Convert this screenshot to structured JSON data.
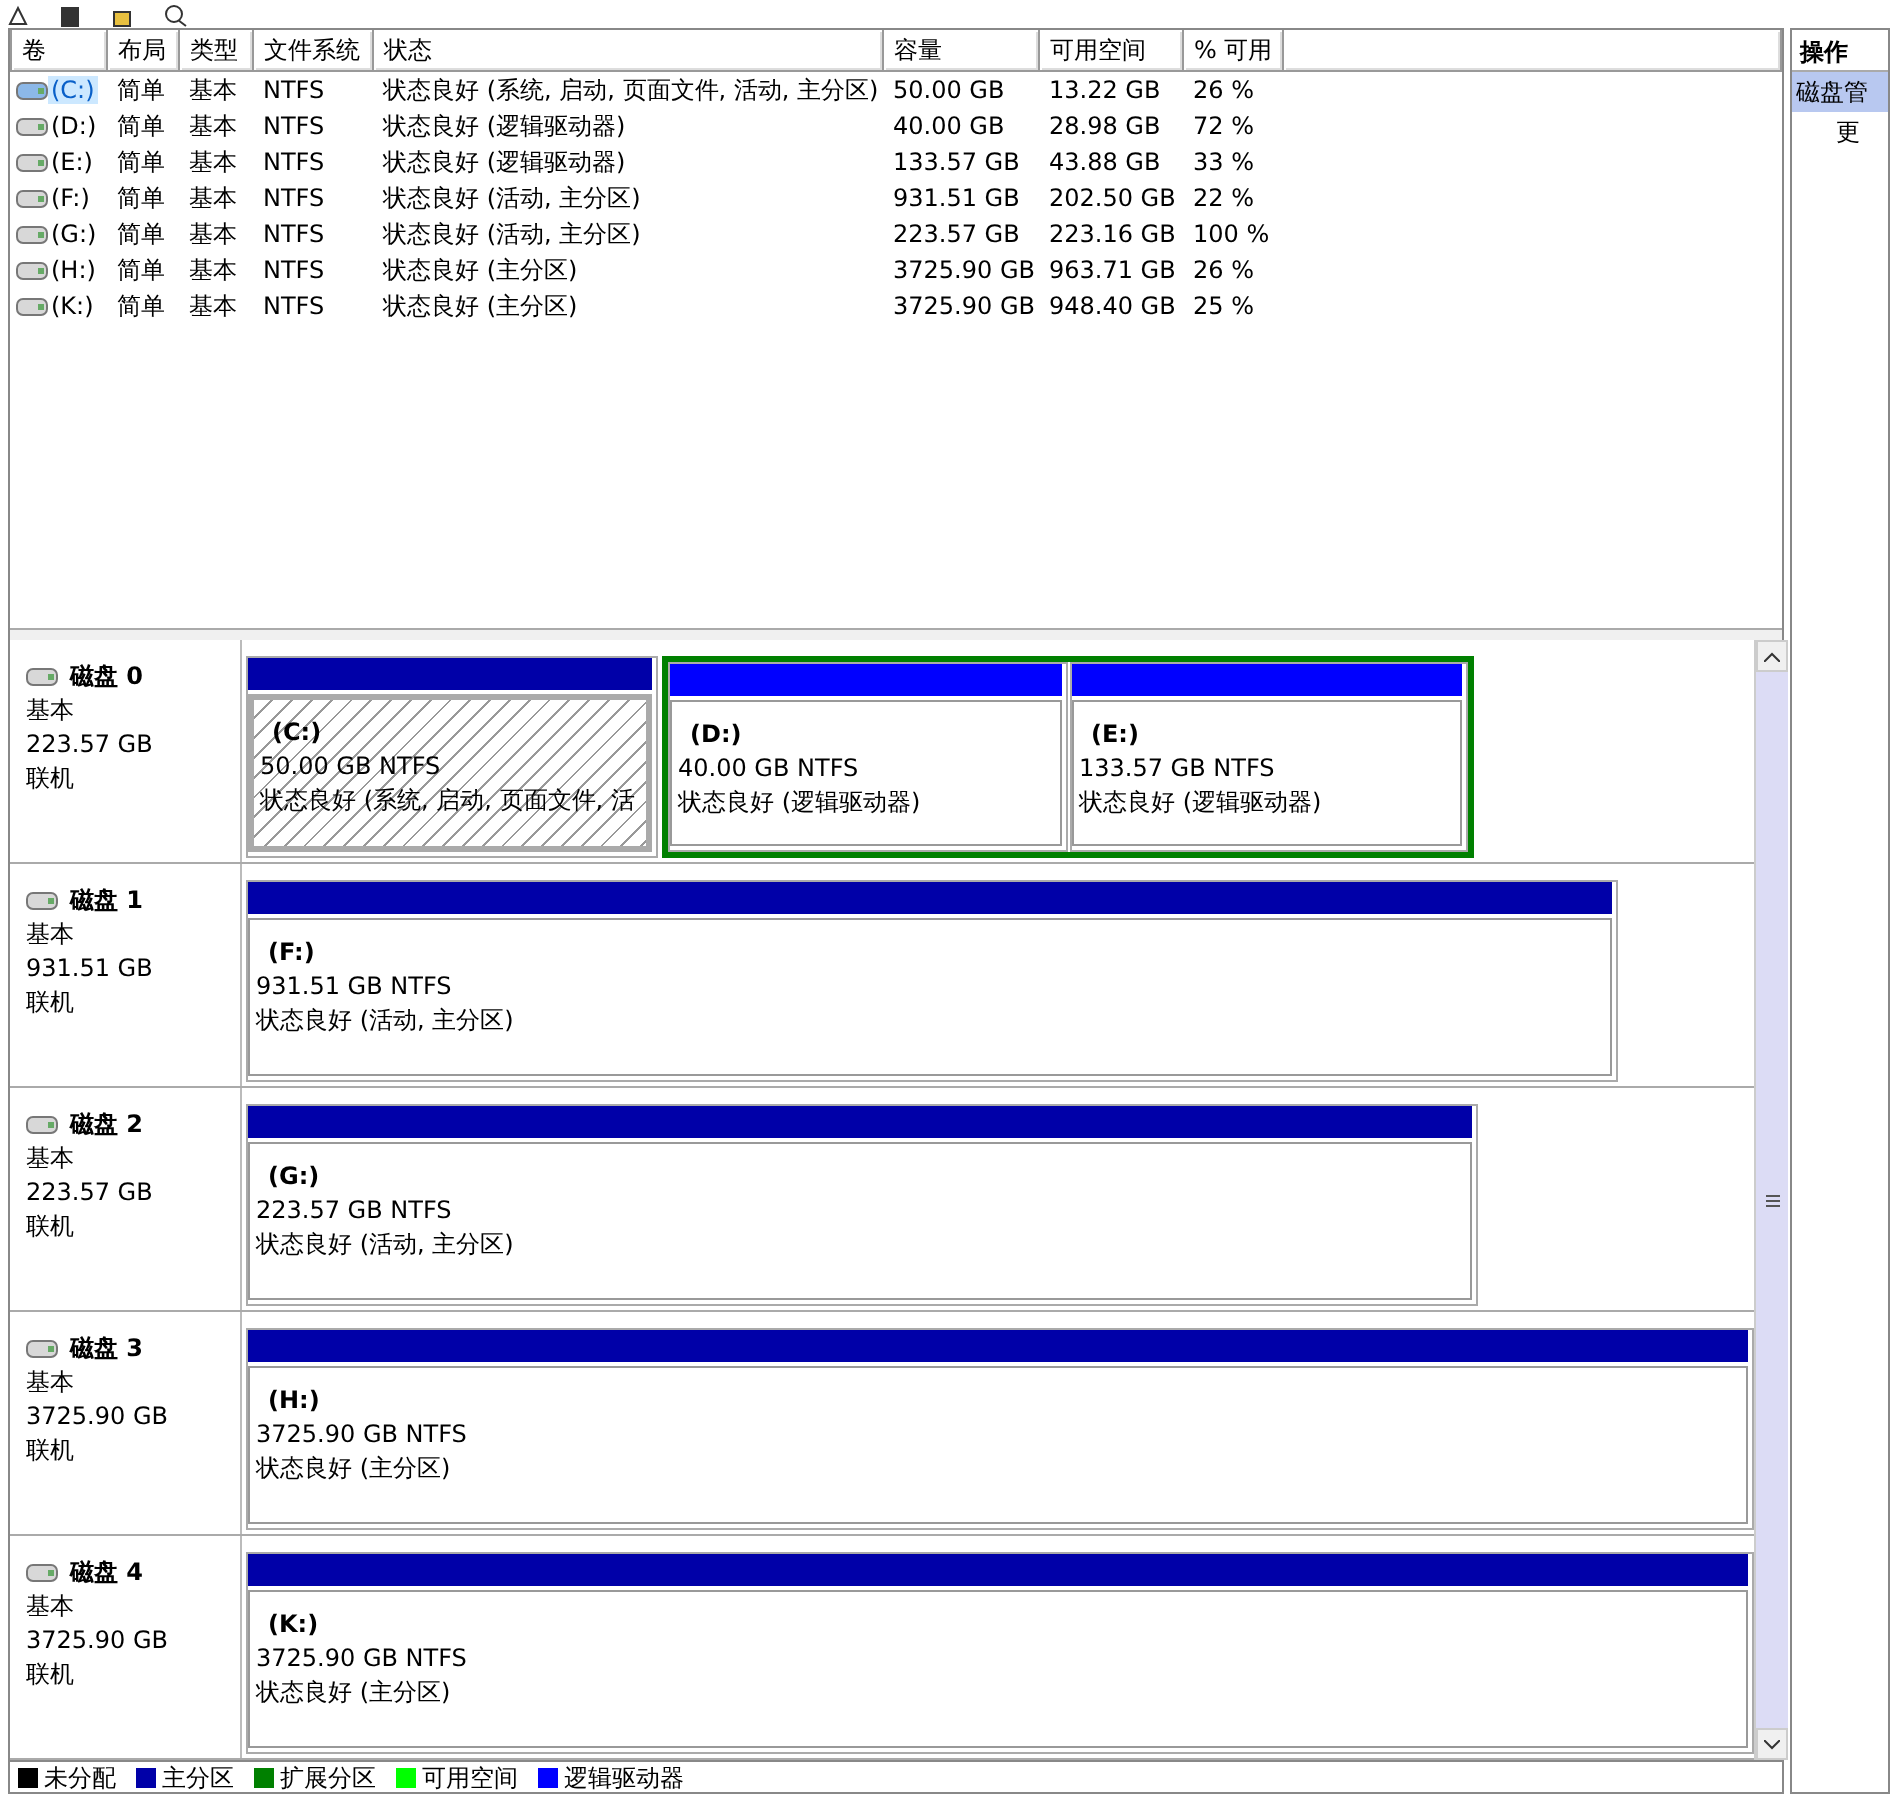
{
  "volume_list": {
    "columns": [
      "卷",
      "布局",
      "类型",
      "文件系统",
      "状态",
      "容量",
      "可用空间",
      "% 可用"
    ],
    "rows": [
      {
        "volume": "(C:)",
        "layout": "简单",
        "type": "基本",
        "file_system": "NTFS",
        "status": "状态良好 (系统, 启动, 页面文件, 活动, 主分区)",
        "capacity": "50.00 GB",
        "free_space": "13.22 GB",
        "percent_free": "26 %",
        "selected": true
      },
      {
        "volume": "(D:)",
        "layout": "简单",
        "type": "基本",
        "file_system": "NTFS",
        "status": "状态良好 (逻辑驱动器)",
        "capacity": "40.00 GB",
        "free_space": "28.98 GB",
        "percent_free": "72 %",
        "selected": false
      },
      {
        "volume": "(E:)",
        "layout": "简单",
        "type": "基本",
        "file_system": "NTFS",
        "status": "状态良好 (逻辑驱动器)",
        "capacity": "133.57 GB",
        "free_space": "43.88 GB",
        "percent_free": "33 %",
        "selected": false
      },
      {
        "volume": "(F:)",
        "layout": "简单",
        "type": "基本",
        "file_system": "NTFS",
        "status": "状态良好 (活动, 主分区)",
        "capacity": "931.51 GB",
        "free_space": "202.50 GB",
        "percent_free": "22 %",
        "selected": false
      },
      {
        "volume": "(G:)",
        "layout": "简单",
        "type": "基本",
        "file_system": "NTFS",
        "status": "状态良好 (活动, 主分区)",
        "capacity": "223.57 GB",
        "free_space": "223.16 GB",
        "percent_free": "100 %",
        "selected": false
      },
      {
        "volume": "(H:)",
        "layout": "简单",
        "type": "基本",
        "file_system": "NTFS",
        "status": "状态良好 (主分区)",
        "capacity": "3725.90 GB",
        "free_space": "963.71 GB",
        "percent_free": "26 %",
        "selected": false
      },
      {
        "volume": "(K:)",
        "layout": "简单",
        "type": "基本",
        "file_system": "NTFS",
        "status": "状态良好 (主分区)",
        "capacity": "3725.90 GB",
        "free_space": "948.40 GB",
        "percent_free": "25 %",
        "selected": false
      }
    ]
  },
  "disks": [
    {
      "name": "磁盘 0",
      "type": "基本",
      "size": "223.57 GB",
      "status": "联机",
      "partitions": [
        {
          "kind": "primary",
          "label": "(C:)",
          "size": "50.00 GB NTFS",
          "status": "状态良好 (系统, 启动, 页面文件, 活",
          "selected": true
        },
        {
          "kind": "extended",
          "selected": false,
          "children": [
            {
              "kind": "logical",
              "label": "(D:)",
              "size": "40.00 GB NTFS",
              "status": "状态良好 (逻辑驱动器)",
              "selected": false
            },
            {
              "kind": "logical",
              "label": "(E:)",
              "size": "133.57 GB NTFS",
              "status": "状态良好 (逻辑驱动器)",
              "selected": false
            }
          ]
        }
      ]
    },
    {
      "name": "磁盘 1",
      "type": "基本",
      "size": "931.51 GB",
      "status": "联机",
      "partitions": [
        {
          "kind": "primary",
          "label": "(F:)",
          "size": "931.51 GB NTFS",
          "status": "状态良好 (活动, 主分区)",
          "selected": false
        }
      ]
    },
    {
      "name": "磁盘 2",
      "type": "基本",
      "size": "223.57 GB",
      "status": "联机",
      "partitions": [
        {
          "kind": "primary",
          "label": "(G:)",
          "size": "223.57 GB NTFS",
          "status": "状态良好 (活动, 主分区)",
          "selected": false
        }
      ]
    },
    {
      "name": "磁盘 3",
      "type": "基本",
      "size": "3725.90 GB",
      "status": "联机",
      "partitions": [
        {
          "kind": "primary",
          "label": "(H:)",
          "size": "3725.90 GB NTFS",
          "status": "状态良好 (主分区)",
          "selected": false
        }
      ]
    },
    {
      "name": "磁盘 4",
      "type": "基本",
      "size": "3725.90 GB",
      "status": "联机",
      "partitions": [
        {
          "kind": "primary",
          "label": "(K:)",
          "size": "3725.90 GB NTFS",
          "status": "状态良好 (主分区)",
          "selected": false
        }
      ]
    }
  ],
  "legend": [
    {
      "label": "未分配",
      "color": "#000000"
    },
    {
      "label": "主分区",
      "color": "#0000a8"
    },
    {
      "label": "扩展分区",
      "color": "#008000"
    },
    {
      "label": "可用空间",
      "color": "#00ff00"
    },
    {
      "label": "逻辑驱动器",
      "color": "#0000ff"
    }
  ],
  "actions_panel": {
    "title": "操作",
    "section": "磁盘管",
    "item": "更"
  }
}
